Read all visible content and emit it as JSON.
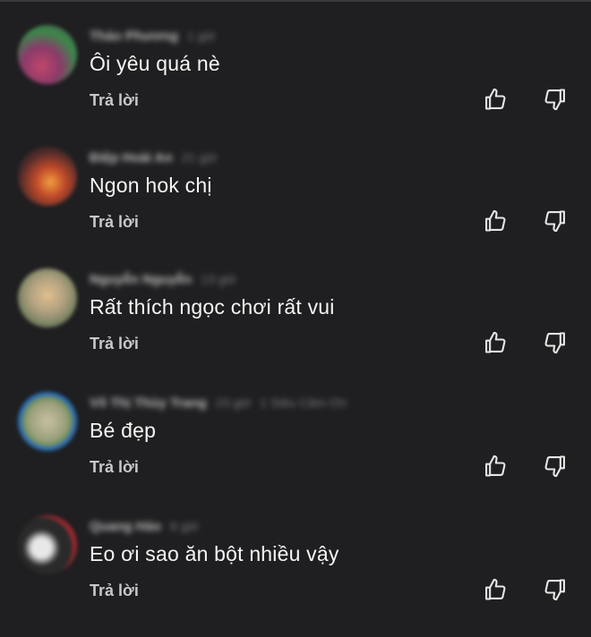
{
  "actions": {
    "reply_label": "Trả lời",
    "like_icon": "thumbs-up-icon",
    "dislike_icon": "thumbs-down-icon"
  },
  "comments": [
    {
      "author": "Thảo Phương",
      "time": "1 giờ",
      "extra": "",
      "text": "Ôi yêu quá nè",
      "avatar_colors": [
        "#6a3a6a",
        "#c0476a",
        "#3a8a4a"
      ]
    },
    {
      "author": "Điệp Hoài An",
      "time": "21 giờ",
      "extra": "",
      "text": "Ngon hok chị",
      "avatar_colors": [
        "#3a2a2a",
        "#c24a2a",
        "#f0a040"
      ]
    },
    {
      "author": "Nguyễn Nguyễn",
      "time": "13 giờ",
      "extra": "",
      "text": "Rất thích ngọc chơi rất vui",
      "avatar_colors": [
        "#b0a080",
        "#e0c090",
        "#5a7a5a"
      ]
    },
    {
      "author": "Võ Thị Thùy Trang",
      "time": "23 giờ",
      "extra": "1 Siêu Cảm Ơn",
      "text": "Bé đẹp",
      "avatar_colors": [
        "#2e6fb8",
        "#c8c0a0",
        "#8a9a70"
      ]
    },
    {
      "author": "Quang Hảo",
      "time": "6 giờ",
      "extra": "",
      "text": "Eo ơi sao ăn bột nhiều vậy",
      "avatar_colors": [
        "#2a2a2a",
        "#e8e8e8",
        "#a02a30"
      ]
    }
  ]
}
